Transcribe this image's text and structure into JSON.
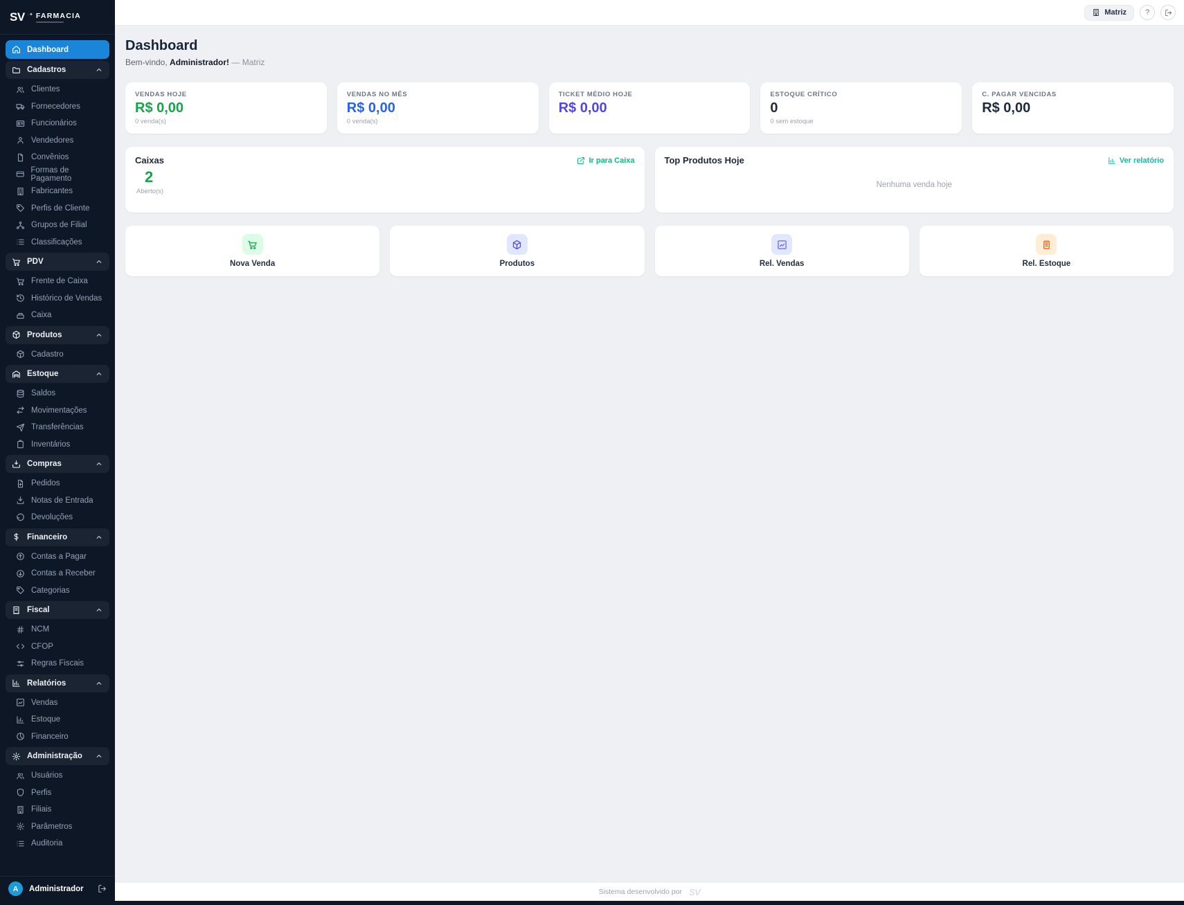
{
  "app": {
    "logo_sv": "SV",
    "logo_name": "FARMACIA"
  },
  "header": {
    "branch_label": "Matriz",
    "help_label": "?"
  },
  "page": {
    "title": "Dashboard",
    "welcome_prefix": "Bem-vindo,",
    "welcome_user": "Administrador!",
    "welcome_suffix": "— Matriz"
  },
  "colors": {
    "sidebar_bg": "#0e1726",
    "active_blue": "#1b86d9",
    "green": "#16a34a",
    "blue": "#2563eb",
    "indigo": "#4f46e5",
    "dark": "#1e293b",
    "link_green": "#10b981",
    "link_teal": "#14b8a6",
    "orange": "#ea580c"
  },
  "sidebar": {
    "top": [
      {
        "icon": "home",
        "label": "Dashboard",
        "active": true
      }
    ],
    "sections": [
      {
        "icon": "folder",
        "label": "Cadastros",
        "children": [
          {
            "icon": "users",
            "label": "Clientes"
          },
          {
            "icon": "truck",
            "label": "Fornecedores"
          },
          {
            "icon": "id-card",
            "label": "Funcionários"
          },
          {
            "icon": "user",
            "label": "Vendedores"
          },
          {
            "icon": "file",
            "label": "Convênios"
          },
          {
            "icon": "credit-card",
            "label": "Formas de Pagamento"
          },
          {
            "icon": "building",
            "label": "Fabricantes"
          },
          {
            "icon": "tag",
            "label": "Perfis de Cliente"
          },
          {
            "icon": "network",
            "label": "Grupos de Filial"
          },
          {
            "icon": "list",
            "label": "Classificações"
          }
        ]
      },
      {
        "icon": "cart",
        "label": "PDV",
        "children": [
          {
            "icon": "cart",
            "label": "Frente de Caixa"
          },
          {
            "icon": "history",
            "label": "Histórico de Vendas"
          },
          {
            "icon": "cash-register",
            "label": "Caixa"
          }
        ]
      },
      {
        "icon": "cube",
        "label": "Produtos",
        "children": [
          {
            "icon": "cube",
            "label": "Cadastro"
          }
        ]
      },
      {
        "icon": "warehouse",
        "label": "Estoque",
        "children": [
          {
            "icon": "database",
            "label": "Saldos"
          },
          {
            "icon": "arrows-lr",
            "label": "Movimentações"
          },
          {
            "icon": "send",
            "label": "Transferências"
          },
          {
            "icon": "clipboard",
            "label": "Inventários"
          }
        ]
      },
      {
        "icon": "inbox-in",
        "label": "Compras",
        "children": [
          {
            "icon": "file-plus",
            "label": "Pedidos"
          },
          {
            "icon": "download",
            "label": "Notas de Entrada"
          },
          {
            "icon": "undo",
            "label": "Devoluções"
          }
        ]
      },
      {
        "icon": "dollar",
        "label": "Financeiro",
        "children": [
          {
            "icon": "arrow-up-circle",
            "label": "Contas a Pagar"
          },
          {
            "icon": "arrow-down-circle",
            "label": "Contas a Receber"
          },
          {
            "icon": "tag",
            "label": "Categorias"
          }
        ]
      },
      {
        "icon": "receipt",
        "label": "Fiscal",
        "children": [
          {
            "icon": "hash",
            "label": "NCM"
          },
          {
            "icon": "code",
            "label": "CFOP"
          },
          {
            "icon": "sliders",
            "label": "Regras Fiscais"
          }
        ]
      },
      {
        "icon": "bar-chart",
        "label": "Relatórios",
        "children": [
          {
            "icon": "line-chart",
            "label": "Vendas"
          },
          {
            "icon": "bar-chart",
            "label": "Estoque"
          },
          {
            "icon": "pie-chart",
            "label": "Financeiro"
          }
        ]
      },
      {
        "icon": "gear",
        "label": "Administração",
        "children": [
          {
            "icon": "users",
            "label": "Usuários"
          },
          {
            "icon": "shield",
            "label": "Perfis"
          },
          {
            "icon": "building",
            "label": "Filiais"
          },
          {
            "icon": "gear",
            "label": "Parâmetros"
          },
          {
            "icon": "list",
            "label": "Auditoria"
          }
        ]
      }
    ],
    "user": {
      "initial": "A",
      "name": "Administrador"
    }
  },
  "stats": [
    {
      "label": "VENDAS HOJE",
      "value": "R$ 0,00",
      "sub": "0 venda(s)",
      "color": "#16a34a"
    },
    {
      "label": "VENDAS NO MÊS",
      "value": "R$ 0,00",
      "sub": "0 venda(s)",
      "color": "#2563eb"
    },
    {
      "label": "TICKET MÉDIO HOJE",
      "value": "R$ 0,00",
      "sub": "",
      "color": "#4f46e5"
    },
    {
      "label": "ESTOQUE CRÍTICO",
      "value": "0",
      "sub": "0 sem estoque",
      "color": "#1e293b"
    },
    {
      "label": "C. PAGAR VENCIDAS",
      "value": "R$ 0,00",
      "sub": "",
      "color": "#1e293b"
    }
  ],
  "caixas": {
    "title": "Caixas",
    "link": "Ir para Caixa",
    "value": "2",
    "sub": "Aberto(s)"
  },
  "top_produtos": {
    "title": "Top Produtos Hoje",
    "link": "Ver relatório",
    "empty": "Nenhuma venda hoje"
  },
  "quick_actions": [
    {
      "icon": "cart",
      "label": "Nova Venda",
      "fg": "#16a34a",
      "bg": "#dcfce7"
    },
    {
      "icon": "cube",
      "label": "Produtos",
      "fg": "#4f46e5",
      "bg": "#e0e7ff"
    },
    {
      "icon": "line-chart",
      "label": "Rel. Vendas",
      "fg": "#6366f1",
      "bg": "#e0e7ff"
    },
    {
      "icon": "archive",
      "label": "Rel. Estoque",
      "fg": "#ea580c",
      "bg": "#ffedd5"
    }
  ],
  "footer": {
    "text": "Sistema desenvolvido por",
    "logo": "SV"
  }
}
